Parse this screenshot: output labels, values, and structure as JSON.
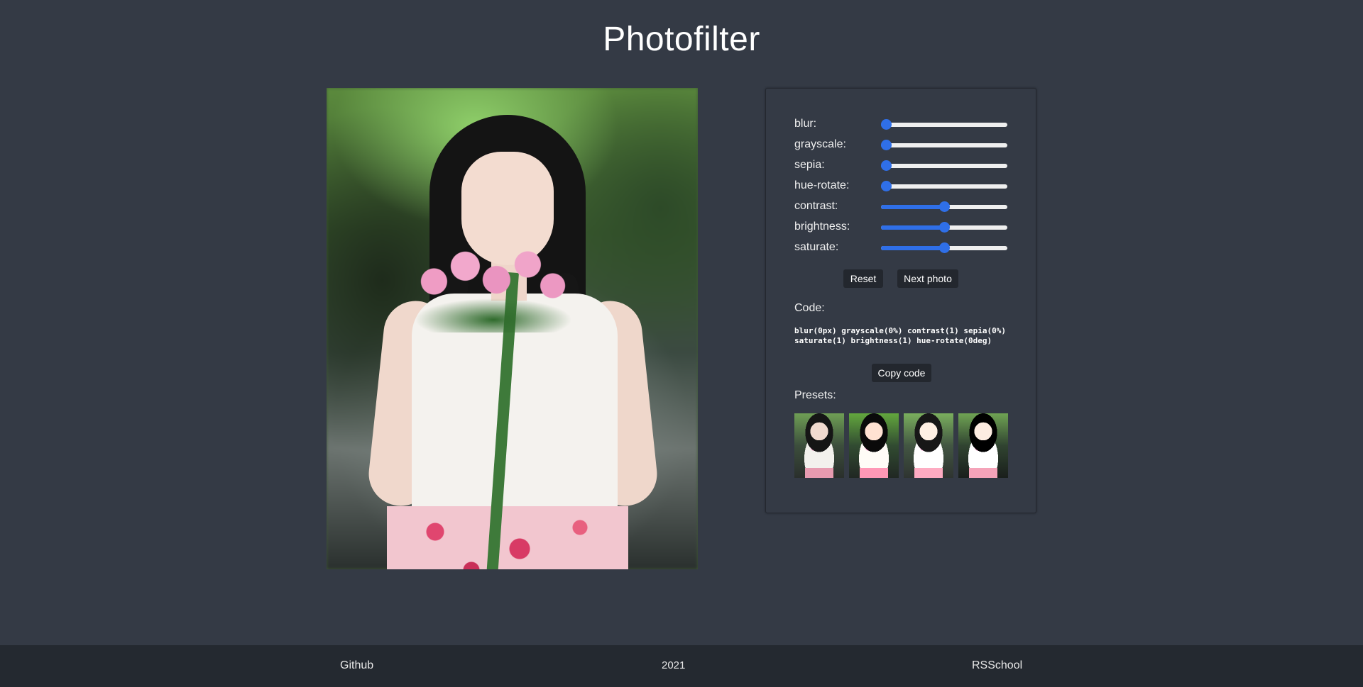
{
  "header": {
    "title": "Photofilter"
  },
  "photo": {
    "alt": "Girl holding pink roses"
  },
  "filters": [
    {
      "label": "blur:",
      "value": 0
    },
    {
      "label": "grayscale:",
      "value": 0
    },
    {
      "label": "sepia:",
      "value": 0
    },
    {
      "label": "hue-rotate:",
      "value": 0
    },
    {
      "label": "contrast:",
      "value": 0.5
    },
    {
      "label": "brightness:",
      "value": 0.5
    },
    {
      "label": "saturate:",
      "value": 0.5
    }
  ],
  "buttons": {
    "reset": "Reset",
    "next_photo": "Next photo",
    "copy_code": "Copy code"
  },
  "code": {
    "label": "Code:",
    "text": "blur(0px) grayscale(0%) contrast(1) sepia(0%) saturate(1) brightness(1) hue-rotate(0deg)"
  },
  "presets": {
    "label": "Presets:",
    "items": [
      "preset-1",
      "preset-2",
      "preset-3",
      "preset-4"
    ]
  },
  "footer": {
    "github": "Github",
    "year": "2021",
    "school": "RSSchool"
  },
  "colors": {
    "background": "#343a45",
    "footer": "#242930",
    "accent": "#2f6fe8",
    "button": "#23272e"
  }
}
